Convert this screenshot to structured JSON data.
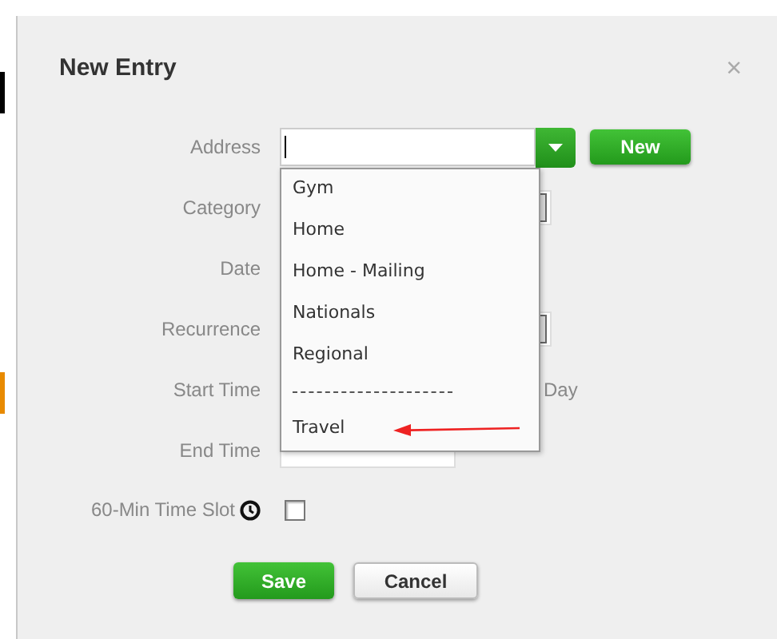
{
  "dialog": {
    "title": "New Entry",
    "close": "×"
  },
  "address": {
    "label": "Address",
    "focused": true,
    "new_button": "New",
    "dropdown": [
      {
        "kind": "option",
        "label": "Gym",
        "marked": false
      },
      {
        "kind": "option",
        "label": "Home",
        "marked": false
      },
      {
        "kind": "option",
        "label": "Home - Mailing",
        "marked": false
      },
      {
        "kind": "option",
        "label": "Nationals",
        "marked": false
      },
      {
        "kind": "option",
        "label": "Regional",
        "marked": false
      },
      {
        "kind": "separator"
      },
      {
        "kind": "option",
        "label": "Travel",
        "marked": true
      }
    ]
  },
  "fields": [
    {
      "label": "Category",
      "kind": "select"
    },
    {
      "label": "Date",
      "kind": "covered"
    },
    {
      "label": "Recurrence",
      "kind": "select"
    },
    {
      "label": "Start Time",
      "kind": "covered",
      "suffix": "Day"
    },
    {
      "label": "End Time",
      "kind": "short-text"
    },
    {
      "label": "60-Min Time Slot",
      "kind": "checkbox",
      "checked": false
    }
  ],
  "buttons": [
    {
      "label": "Save",
      "kind": "primary"
    },
    {
      "label": "Cancel",
      "kind": "default"
    }
  ]
}
